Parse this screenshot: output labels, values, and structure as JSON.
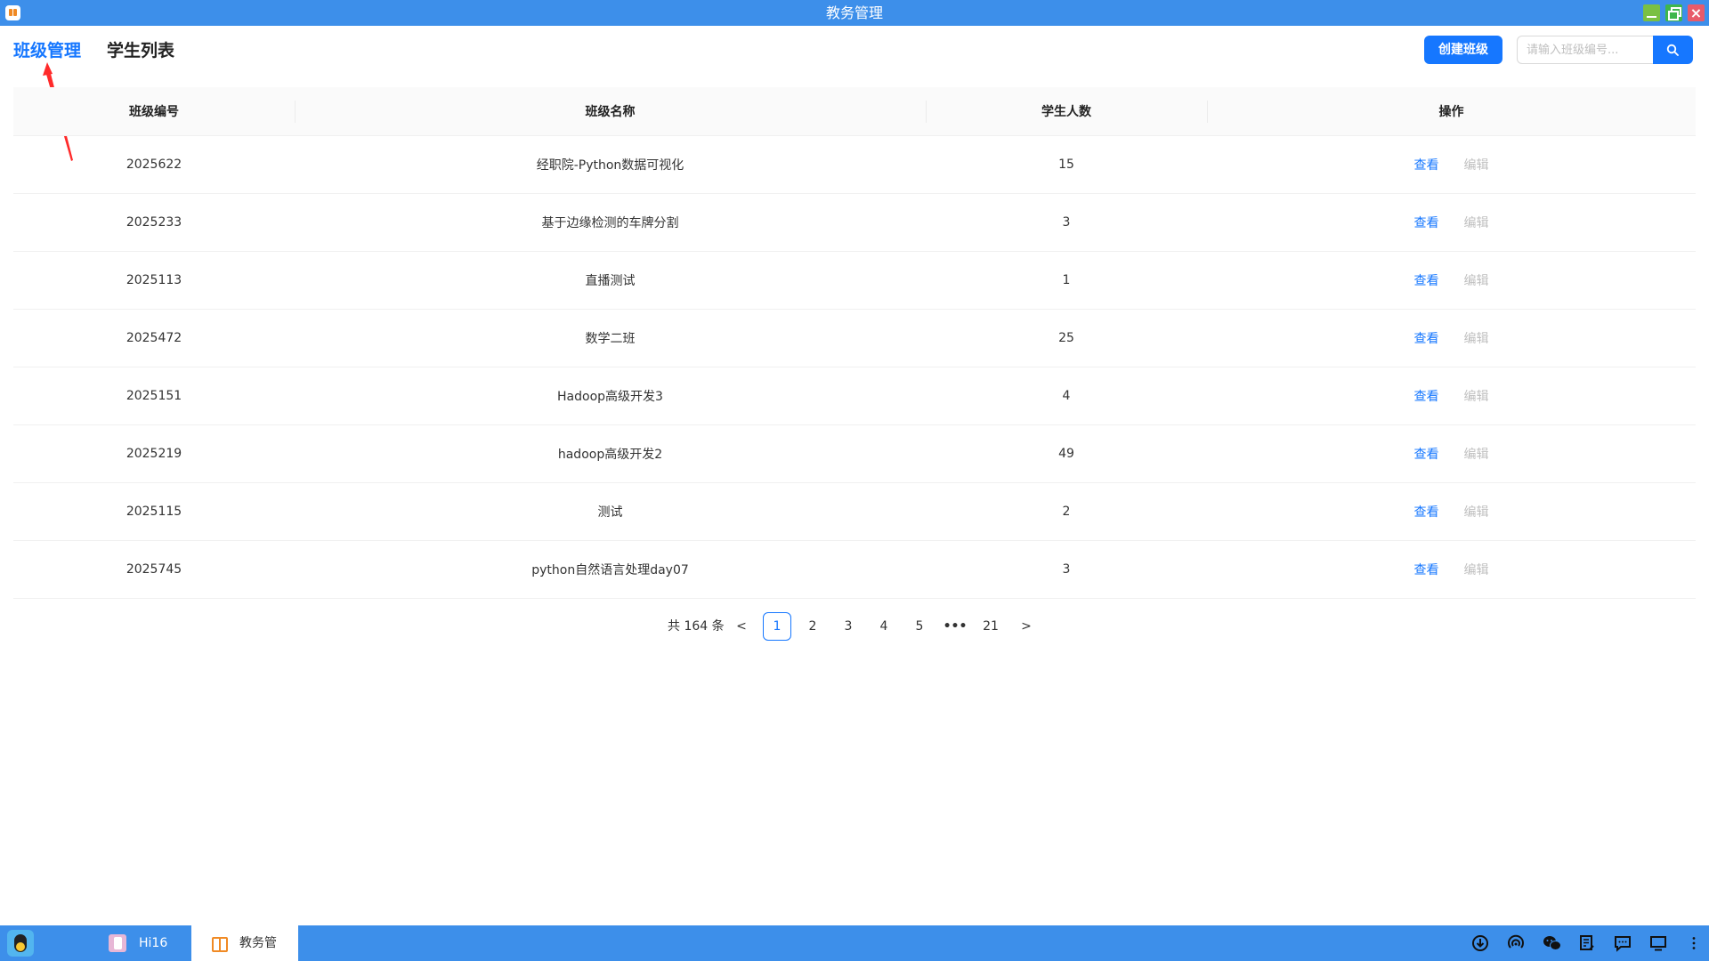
{
  "window": {
    "title": "教务管理"
  },
  "nav": {
    "tab_active": "班级管理",
    "tab_other": "学生列表"
  },
  "toolbar": {
    "create_label": "创建班级",
    "search_placeholder": "请输入班级编号..."
  },
  "table": {
    "headers": {
      "id": "班级编号",
      "name": "班级名称",
      "count": "学生人数",
      "ops": "操作"
    },
    "rows": [
      {
        "id": "2025622",
        "name": "经职院-Python数据可视化",
        "count": "15",
        "view": "查看",
        "edit": "编辑"
      },
      {
        "id": "2025233",
        "name": "基于边缘检测的车牌分割",
        "count": "3",
        "view": "查看",
        "edit": "编辑"
      },
      {
        "id": "2025113",
        "name": "直播测试",
        "count": "1",
        "view": "查看",
        "edit": "编辑"
      },
      {
        "id": "2025472",
        "name": "数学二班",
        "count": "25",
        "view": "查看",
        "edit": "编辑"
      },
      {
        "id": "2025151",
        "name": "Hadoop高级开发3",
        "count": "4",
        "view": "查看",
        "edit": "编辑"
      },
      {
        "id": "2025219",
        "name": "hadoop高级开发2",
        "count": "49",
        "view": "查看",
        "edit": "编辑"
      },
      {
        "id": "2025115",
        "name": "测试",
        "count": "2",
        "view": "查看",
        "edit": "编辑"
      },
      {
        "id": "2025745",
        "name": "python自然语言处理day07",
        "count": "3",
        "view": "查看",
        "edit": "编辑"
      }
    ]
  },
  "pagination": {
    "total_text": "共 164 条",
    "prev": "<",
    "pages": [
      "1",
      "2",
      "3",
      "4",
      "5"
    ],
    "ellipsis": "•••",
    "last": "21",
    "next": ">",
    "current": 1
  },
  "taskbar": {
    "tasks": [
      {
        "label": "Hi16"
      },
      {
        "label": "教务管"
      }
    ],
    "tray_icons": [
      "download-icon",
      "hotspot-icon",
      "wechat-icon",
      "notes-icon",
      "chat-icon",
      "screen-icon",
      "more-icon"
    ]
  },
  "colors": {
    "accent": "#1677ff",
    "titlebar": "#3d8fea",
    "annotation": "#ff2a2a",
    "disabled": "#bfbfbf"
  }
}
